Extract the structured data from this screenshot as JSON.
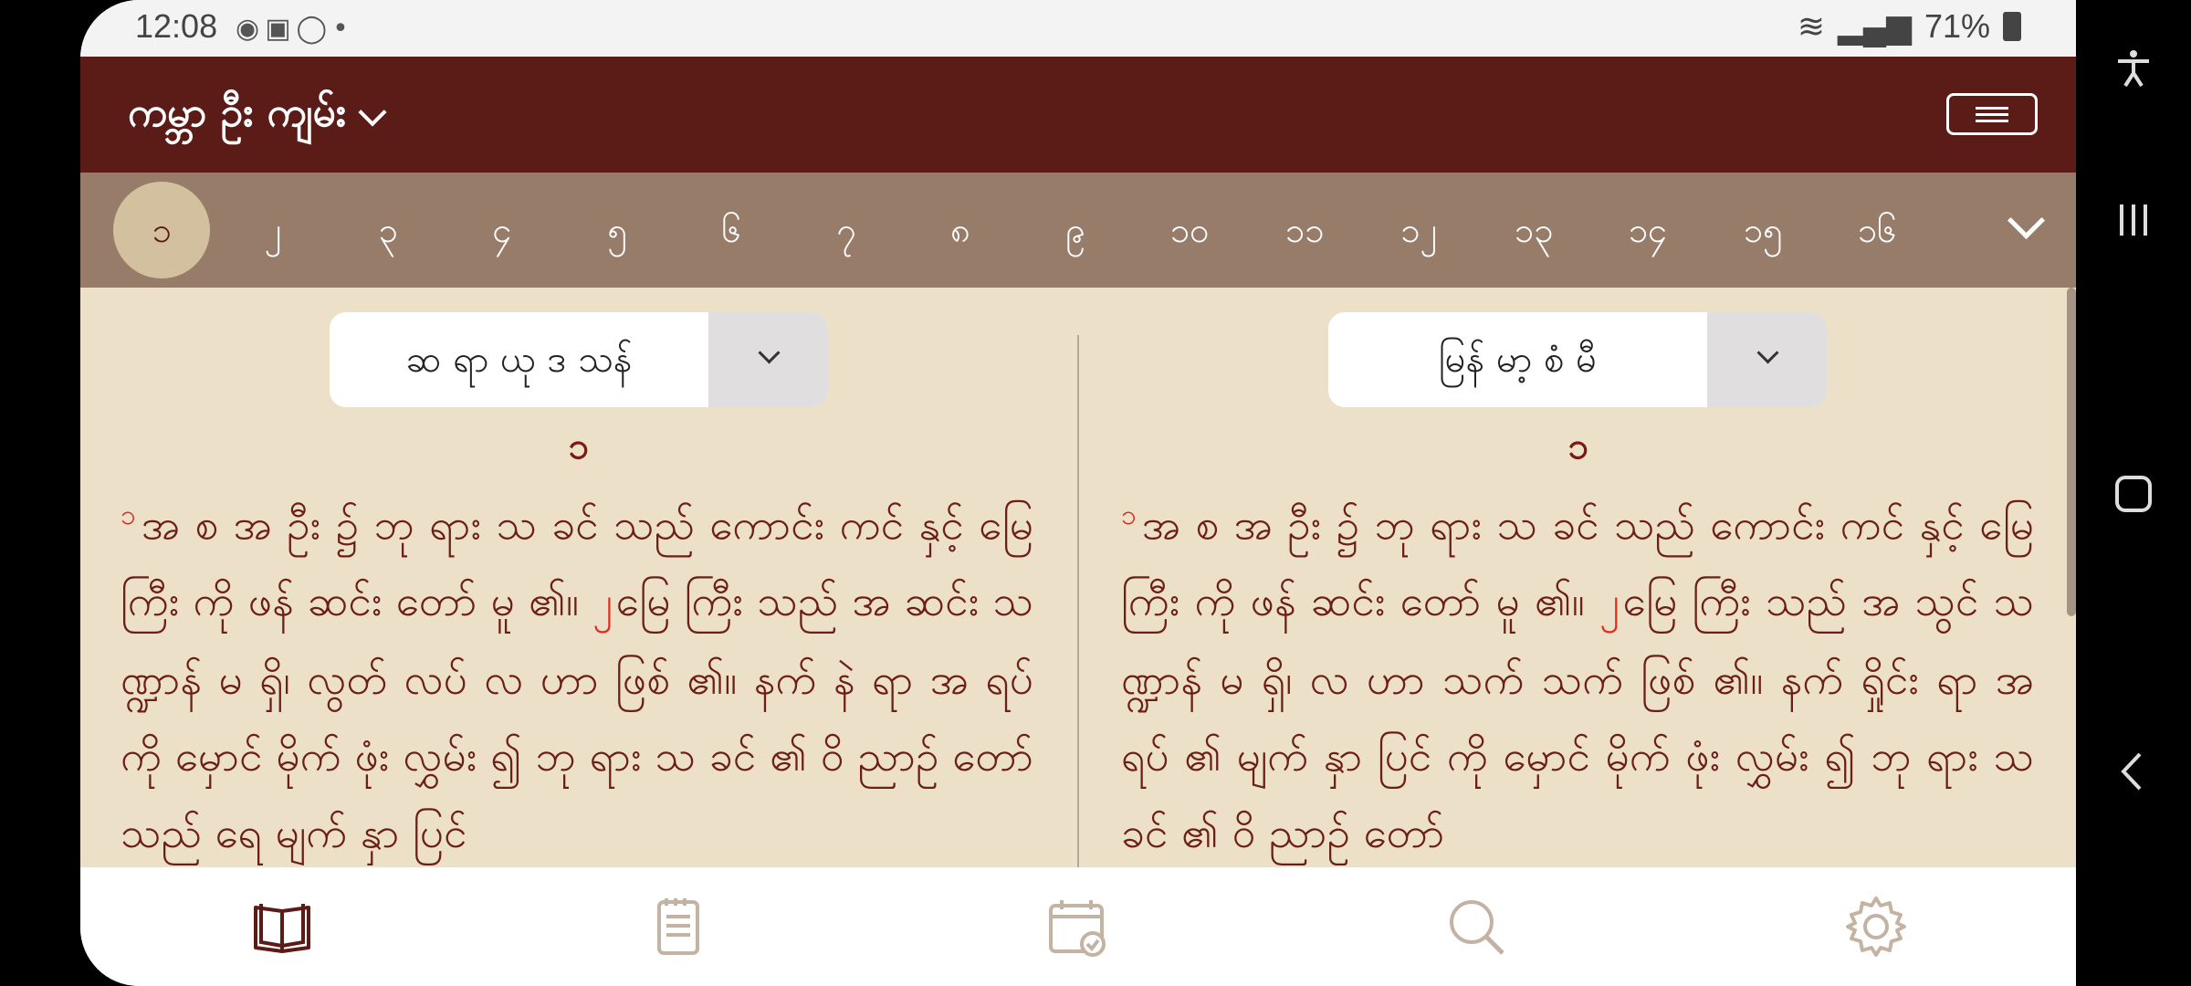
{
  "status_bar": {
    "time": "12:08",
    "notification_icons": [
      "sync-icon",
      "device-icon",
      "whatsapp-icon",
      "dot-icon"
    ],
    "battery": "71%"
  },
  "app_bar": {
    "book_title": "ကမ္ဘာ ဦး ကျမ်း",
    "menu_icon": "hamburger-icon"
  },
  "chapters": {
    "items": [
      "၁",
      "၂",
      "၃",
      "၄",
      "၅",
      "၆",
      "၇",
      "၈",
      "၉",
      "၁၀",
      "၁၁",
      "၁၂",
      "၁၃",
      "၁၄",
      "၁၅",
      "၁၆"
    ],
    "active_index": 0
  },
  "left_panel": {
    "version_label": "ဆ ရာ ယု ဒ သန်",
    "chapter_heading": "၁",
    "v1_num": "၁",
    "v1_text": "အ စ အ ဦး ၌ ဘု ရား သ ခင် သည် ကောင်း ကင် နှင့် မြေ ကြီး ကို ဖန် ဆင်း တော် မူ ၏။",
    "v2_num": "၂",
    "v2_text": "မြေ ကြီး သည် အ ဆင်း သဏ္ဍာန် မ ရှိ၊ လွတ် လပ် လ ဟာ ဖြစ် ၏။ နက် နဲ ရာ အ ရပ် ကို မှောင် မိုက် ဖုံး လွှမ်း ၍ ဘု ရား သ ခင် ၏ ဝိ ညာဉ် တော် သည် ရေ မျက် နှာ ပြင်"
  },
  "right_panel": {
    "version_label": "မြန် မာ့ စံ မီ",
    "chapter_heading": "၁",
    "v1_num": "၁",
    "v1_text": "အ စ အ ဦး ၌ ဘု ရား သ ခင် သည် ကောင်း ကင် နှင့် မြေ ကြီး ကို ဖန် ဆင်း တော် မူ ၏။",
    "v2_num": "၂",
    "v2_text": "မြေ ကြီး သည် အ သွင် သဏ္ဍာန် မ ရှိ၊ လ ဟာ သက် သက် ဖြစ် ၏။ နက် ရှိုင်း ရာ အ ရပ် ၏ မျက် နှာ ပြင် ကို မှောင် မိုက် ဖုံး လွှမ်း ၍ ဘု ရား သ ခင် ၏ ဝိ ညာဉ် တော်"
  },
  "bottom_nav": {
    "items": [
      "book-icon",
      "notes-icon",
      "calendar-icon",
      "search-icon",
      "settings-icon"
    ],
    "active_color": "#5b1b16",
    "inactive_color": "#c4b3a3"
  },
  "colors": {
    "app_bar": "#5b1b16",
    "chapter_bar": "#977c6a",
    "content_bg": "#ede0c8",
    "verse_number": "#e02a1e"
  }
}
